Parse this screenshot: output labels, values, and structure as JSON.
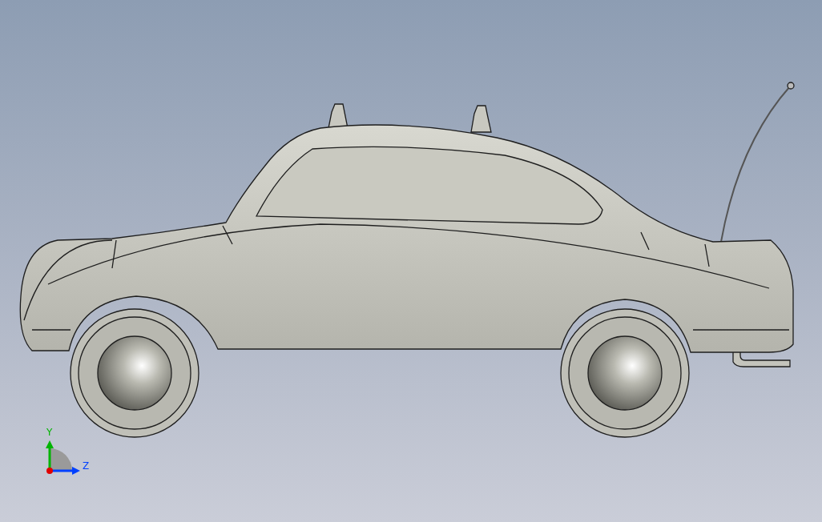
{
  "triad": {
    "axes": [
      {
        "label": "Y",
        "color": "#00b400"
      },
      {
        "label": "Z",
        "color": "#0040ff"
      }
    ]
  }
}
